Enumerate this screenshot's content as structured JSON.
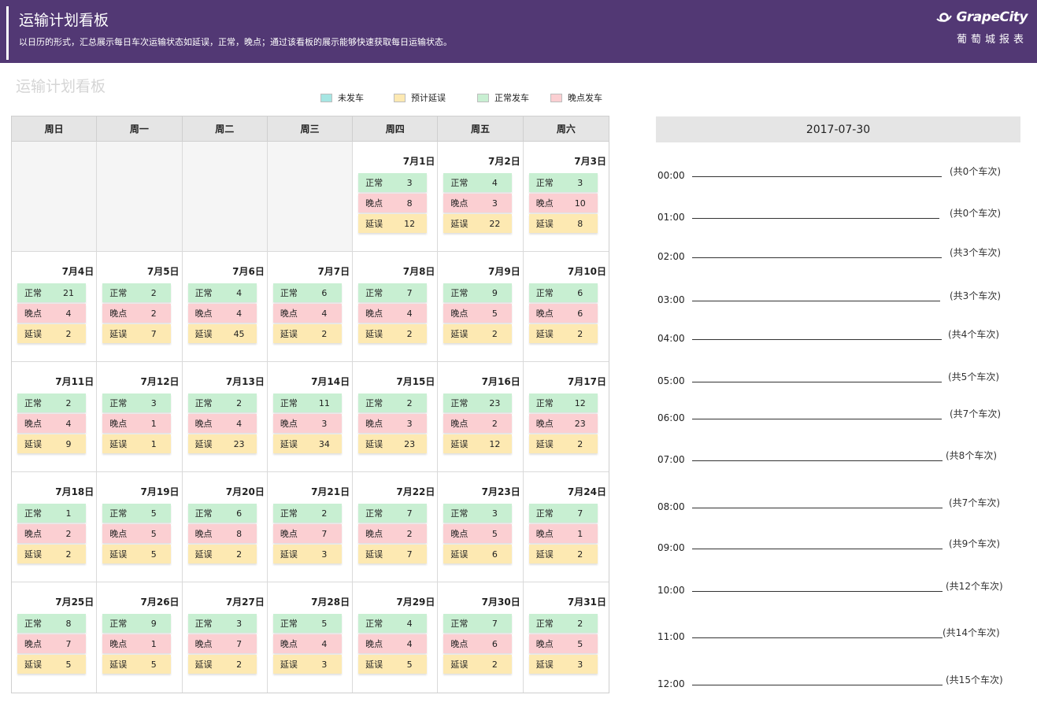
{
  "header": {
    "title": "运输计划看板",
    "subtitle": "以日历的形式，汇总展示每日车次运输状态如延误，正常，晚点；通过该看板的展示能够快速获取每日运输状态。",
    "brand_name": "GrapeCity",
    "brand_tagline": "葡萄城报表"
  },
  "board_title": "运输计划看板",
  "legend": [
    {
      "label": "未发车",
      "color": "#a6e6e3"
    },
    {
      "label": "预计延误",
      "color": "#fde9b2"
    },
    {
      "label": "正常发车",
      "color": "#c8efd2"
    },
    {
      "label": "晚点发车",
      "color": "#fbcfd2"
    }
  ],
  "colors": {
    "normal": "#c8efd2",
    "late": "#fbcfd2",
    "delay": "#fde9b2",
    "header_bg": "#523874"
  },
  "weekdays": [
    "周日",
    "周一",
    "周二",
    "周三",
    "周四",
    "周五",
    "周六"
  ],
  "stat_labels": {
    "normal": "正常",
    "late": "晚点",
    "delay": "延误"
  },
  "leading_blank_days": 4,
  "days": [
    {
      "date": "7月1日",
      "normal": 3,
      "late": 8,
      "delay": 12
    },
    {
      "date": "7月2日",
      "normal": 4,
      "late": 3,
      "delay": 22
    },
    {
      "date": "7月3日",
      "normal": 3,
      "late": 10,
      "delay": 8
    },
    {
      "date": "7月4日",
      "normal": 21,
      "late": 4,
      "delay": 2
    },
    {
      "date": "7月5日",
      "normal": 2,
      "late": 2,
      "delay": 7
    },
    {
      "date": "7月6日",
      "normal": 4,
      "late": 4,
      "delay": 45
    },
    {
      "date": "7月7日",
      "normal": 6,
      "late": 4,
      "delay": 2
    },
    {
      "date": "7月8日",
      "normal": 7,
      "late": 4,
      "delay": 2
    },
    {
      "date": "7月9日",
      "normal": 9,
      "late": 5,
      "delay": 2
    },
    {
      "date": "7月10日",
      "normal": 6,
      "late": 6,
      "delay": 2
    },
    {
      "date": "7月11日",
      "normal": 2,
      "late": 4,
      "delay": 9
    },
    {
      "date": "7月12日",
      "normal": 3,
      "late": 1,
      "delay": 1
    },
    {
      "date": "7月13日",
      "normal": 2,
      "late": 4,
      "delay": 23
    },
    {
      "date": "7月14日",
      "normal": 11,
      "late": 3,
      "delay": 34
    },
    {
      "date": "7月15日",
      "normal": 2,
      "late": 3,
      "delay": 23
    },
    {
      "date": "7月16日",
      "normal": 23,
      "late": 2,
      "delay": 12
    },
    {
      "date": "7月17日",
      "normal": 12,
      "late": 23,
      "delay": 2
    },
    {
      "date": "7月18日",
      "normal": 1,
      "late": 2,
      "delay": 2
    },
    {
      "date": "7月19日",
      "normal": 5,
      "late": 5,
      "delay": 5
    },
    {
      "date": "7月20日",
      "normal": 6,
      "late": 8,
      "delay": 2
    },
    {
      "date": "7月21日",
      "normal": 2,
      "late": 7,
      "delay": 3
    },
    {
      "date": "7月22日",
      "normal": 7,
      "late": 2,
      "delay": 7
    },
    {
      "date": "7月23日",
      "normal": 3,
      "late": 5,
      "delay": 6
    },
    {
      "date": "7月24日",
      "normal": 7,
      "late": 1,
      "delay": 2
    },
    {
      "date": "7月25日",
      "normal": 8,
      "late": 7,
      "delay": 5
    },
    {
      "date": "7月26日",
      "normal": 9,
      "late": 1,
      "delay": 5
    },
    {
      "date": "7月27日",
      "normal": 3,
      "late": 7,
      "delay": 2
    },
    {
      "date": "7月28日",
      "normal": 5,
      "late": 4,
      "delay": 3
    },
    {
      "date": "7月29日",
      "normal": 4,
      "late": 4,
      "delay": 5
    },
    {
      "date": "7月30日",
      "normal": 7,
      "late": 6,
      "delay": 2
    },
    {
      "date": "7月31日",
      "normal": 2,
      "late": 5,
      "delay": 3
    }
  ],
  "day_detail": {
    "date": "2017-07-30",
    "hours": [
      {
        "time": "00:00",
        "count_label": "(共0个车次)"
      },
      {
        "time": "01:00",
        "count_label": "(共0个车次)"
      },
      {
        "time": "02:00",
        "count_label": "(共3个车次)"
      },
      {
        "time": "03:00",
        "count_label": "(共3个车次)"
      },
      {
        "time": "04:00",
        "count_label": "(共4个车次)"
      },
      {
        "time": "05:00",
        "count_label": "(共5个车次)"
      },
      {
        "time": "06:00",
        "count_label": "(共7个车次)"
      },
      {
        "time": "07:00",
        "count_label": "(共8个车次)"
      },
      {
        "time": "08:00",
        "count_label": "(共7个车次)"
      },
      {
        "time": "09:00",
        "count_label": "(共9个车次)"
      },
      {
        "time": "10:00",
        "count_label": "(共12个车次)"
      },
      {
        "time": "11:00",
        "count_label": "(共14个车次)"
      },
      {
        "time": "12:00",
        "count_label": "(共15个车次)"
      }
    ]
  }
}
